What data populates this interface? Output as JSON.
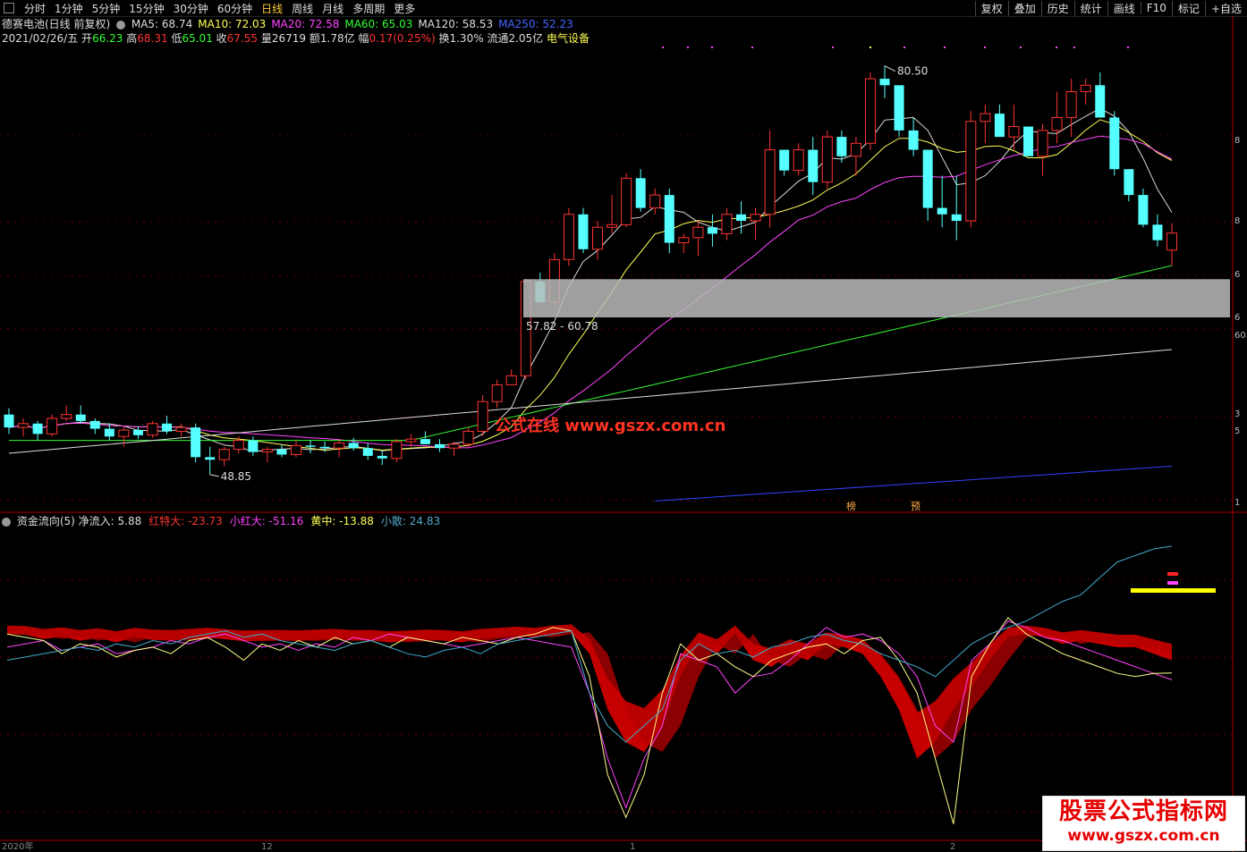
{
  "toolbar": {
    "periods": [
      "分时",
      "1分钟",
      "5分钟",
      "15分钟",
      "30分钟",
      "60分钟",
      "日线",
      "周线",
      "月线",
      "多周期",
      "更多"
    ],
    "active": "日线",
    "right": [
      "复权",
      "叠加",
      "历史",
      "统计",
      "画线",
      "F10",
      "标记",
      "+自选"
    ]
  },
  "header": {
    "stock_name": "德赛电池(日线 前复权)",
    "ma": [
      {
        "label": "MA5: 68.74",
        "color": "#dddddd"
      },
      {
        "label": "MA10: 72.03",
        "color": "#ffff55"
      },
      {
        "label": "MA20: 72.58",
        "color": "#ff44ff"
      },
      {
        "label": "MA60: 65.03",
        "color": "#33ff33"
      },
      {
        "label": "MA120: 58.53",
        "color": "#dddddd"
      },
      {
        "label": "MA250: 52.23",
        "color": "#4466ff"
      }
    ],
    "date": "2021/02/26/五",
    "open_label": "开",
    "open": "66.23",
    "high_label": "高",
    "high": "68.31",
    "low_label": "低",
    "low": "65.01",
    "close_label": "收",
    "close": "67.55",
    "volume": "量26719",
    "amount": "额1.78亿",
    "change_label": "幅",
    "change": "0.17(0.25%)",
    "turnover": "换1.30%",
    "float": "流通2.05亿",
    "sector": "电气设备"
  },
  "annotations": {
    "high_marker": "80.50",
    "low_marker": "48.85",
    "range_box": "57.82 - 60.78",
    "badge1": "榜",
    "badge2": "预"
  },
  "watermark": "公式在线 www.gszx.com.cn",
  "logo": {
    "line1": "股票公式指标网",
    "line2": "www.gszx.com.cn"
  },
  "indicator": {
    "name": "资金流向(5)",
    "items": [
      {
        "label": "净流入: 5.88",
        "color": "#dddddd"
      },
      {
        "label": "红特大: -23.73",
        "color": "#ff3333"
      },
      {
        "label": "小红大: -51.16",
        "color": "#ff44ff"
      },
      {
        "label": "黄中: -13.88",
        "color": "#ffff55"
      },
      {
        "label": "小散: 24.83",
        "color": "#55aacc"
      }
    ]
  },
  "axis": {
    "price_ticks": [
      "8",
      "8",
      "6",
      "6",
      "60.",
      "3",
      "5",
      "1",
      "5"
    ],
    "x_labels": [
      "2020年",
      "12",
      "1",
      "2"
    ]
  },
  "colors": {
    "up": "#ff3333",
    "down": "#55ffff",
    "ma5": "#dddddd",
    "ma10": "#ffff55",
    "ma20": "#ff44ff",
    "ma60": "#33ff33",
    "ma120": "#dddddd",
    "ma250": "#3344ff",
    "grid": "#660000"
  },
  "chart_data": [
    {
      "type": "candlestick",
      "title": "德赛电池(日线 前复权)",
      "ohlc": [
        [
          53.5,
          54.0,
          52.0,
          52.5
        ],
        [
          52.5,
          53.2,
          51.8,
          52.8
        ],
        [
          52.8,
          53.0,
          51.5,
          52.0
        ],
        [
          52.0,
          53.5,
          51.8,
          53.2
        ],
        [
          53.2,
          54.2,
          53.0,
          53.5
        ],
        [
          53.5,
          54.2,
          52.8,
          53.0
        ],
        [
          53.0,
          53.2,
          52.0,
          52.4
        ],
        [
          52.4,
          52.8,
          51.5,
          51.8
        ],
        [
          51.8,
          52.5,
          51.0,
          52.3
        ],
        [
          52.3,
          52.6,
          51.6,
          51.9
        ],
        [
          51.9,
          53.0,
          51.7,
          52.8
        ],
        [
          52.8,
          53.4,
          52.0,
          52.2
        ],
        [
          52.2,
          52.8,
          51.8,
          52.5
        ],
        [
          52.5,
          52.8,
          49.8,
          50.2
        ],
        [
          50.2,
          51.0,
          48.85,
          50.0
        ],
        [
          50.0,
          51.0,
          49.5,
          50.8
        ],
        [
          50.8,
          51.8,
          50.5,
          51.5
        ],
        [
          51.5,
          51.8,
          50.3,
          50.6
        ],
        [
          50.6,
          51.0,
          49.8,
          50.8
        ],
        [
          50.8,
          51.2,
          50.2,
          50.4
        ],
        [
          50.4,
          51.5,
          50.2,
          51.1
        ],
        [
          51.1,
          51.5,
          50.5,
          51.0
        ],
        [
          51.0,
          51.4,
          50.6,
          50.9
        ],
        [
          50.9,
          51.6,
          50.2,
          51.3
        ],
        [
          51.3,
          51.7,
          50.7,
          50.9
        ],
        [
          50.9,
          51.3,
          50.0,
          50.3
        ],
        [
          50.3,
          50.7,
          49.6,
          50.1
        ],
        [
          50.1,
          51.6,
          49.8,
          51.4
        ],
        [
          51.4,
          52.0,
          51.0,
          51.6
        ],
        [
          51.6,
          52.2,
          51.2,
          51.2
        ],
        [
          51.2,
          51.6,
          50.6,
          50.9
        ],
        [
          50.9,
          51.4,
          50.3,
          51.2
        ],
        [
          51.2,
          52.5,
          51.0,
          52.2
        ],
        [
          52.2,
          55.0,
          51.8,
          54.5
        ],
        [
          54.5,
          56.2,
          54.0,
          55.8
        ],
        [
          55.8,
          57.0,
          56.0,
          56.5
        ],
        [
          56.5,
          64.0,
          56.2,
          63.8
        ],
        [
          63.8,
          64.5,
          62.5,
          62.2
        ],
        [
          62.2,
          66.0,
          62.0,
          65.5
        ],
        [
          65.5,
          69.5,
          65.0,
          69.0
        ],
        [
          69.0,
          69.5,
          66.0,
          66.3
        ],
        [
          66.3,
          68.5,
          65.5,
          68.0
        ],
        [
          68.0,
          70.5,
          67.5,
          68.2
        ],
        [
          68.2,
          72.2,
          68.0,
          71.8
        ],
        [
          71.8,
          72.5,
          69.2,
          69.5
        ],
        [
          69.5,
          71.0,
          69.0,
          70.5
        ],
        [
          70.5,
          71.0,
          66.0,
          66.8
        ],
        [
          66.8,
          67.5,
          66.0,
          67.2
        ],
        [
          67.2,
          68.5,
          65.8,
          68.0
        ],
        [
          68.0,
          69.0,
          66.5,
          67.5
        ],
        [
          67.5,
          69.5,
          67.0,
          69.0
        ],
        [
          69.0,
          70.0,
          67.5,
          68.5
        ],
        [
          68.5,
          69.5,
          67.0,
          69.0
        ],
        [
          69.0,
          75.5,
          68.0,
          74.0
        ],
        [
          74.0,
          73.5,
          72.0,
          72.4
        ],
        [
          72.4,
          74.5,
          72.0,
          74.0
        ],
        [
          74.0,
          75.0,
          70.5,
          71.5
        ],
        [
          71.5,
          75.5,
          71.0,
          75.0
        ],
        [
          75.0,
          75.5,
          73.0,
          73.5
        ],
        [
          73.5,
          75.0,
          72.0,
          74.5
        ],
        [
          74.5,
          80.0,
          74.0,
          79.5
        ],
        [
          79.5,
          80.5,
          78.0,
          79.0
        ],
        [
          79.0,
          78.5,
          75.0,
          75.5
        ],
        [
          75.5,
          76.5,
          73.5,
          74.0
        ],
        [
          74.0,
          73.5,
          68.5,
          69.5
        ],
        [
          69.5,
          72.0,
          68.0,
          69.0
        ],
        [
          69.0,
          72.0,
          67.0,
          68.5
        ],
        [
          68.5,
          77.0,
          68.0,
          76.2
        ],
        [
          76.2,
          77.5,
          74.5,
          76.8
        ],
        [
          76.8,
          77.5,
          75.5,
          75.0
        ],
        [
          75.0,
          77.5,
          74.0,
          75.8
        ],
        [
          75.8,
          75.8,
          73.5,
          73.5
        ],
        [
          73.5,
          76.0,
          72.0,
          75.5
        ],
        [
          75.5,
          78.5,
          74.5,
          76.5
        ],
        [
          76.5,
          79.5,
          75.0,
          78.5
        ],
        [
          78.5,
          79.5,
          77.5,
          79.0
        ],
        [
          79.0,
          80.0,
          76.5,
          76.5
        ],
        [
          76.5,
          77.0,
          72.0,
          72.5
        ],
        [
          72.5,
          71.0,
          70.0,
          70.5
        ],
        [
          70.5,
          71.0,
          68.0,
          68.2
        ],
        [
          68.2,
          69.0,
          66.5,
          67.0
        ],
        [
          66.23,
          68.31,
          65.01,
          67.55
        ]
      ],
      "ma": {
        "MA5": 68.74,
        "MA10": 72.03,
        "MA20": 72.58,
        "MA60": 65.03,
        "MA120": 58.53,
        "MA250": 52.23
      },
      "annotations": {
        "high": 80.5,
        "low": 48.85,
        "range": [
          57.82,
          60.78
        ]
      }
    },
    {
      "type": "area",
      "title": "资金流向(5)",
      "series": [
        {
          "name": "红特大",
          "values": [
            -2,
            -2.2,
            -3.5,
            -2.8,
            -4,
            -3.2,
            -4.5,
            -3,
            -3.8,
            -4,
            -3.5,
            -3,
            -3.6,
            -4.2,
            -4,
            -3.9,
            -4.1,
            -3.8,
            -3.5,
            -4,
            -3.9,
            -4.5,
            -4.2,
            -3.8,
            -4,
            -4.5,
            -3.5,
            -3,
            -2.5,
            -3,
            -2,
            -1.5,
            -8,
            -25,
            -35,
            -38,
            -30,
            -15,
            -5,
            -8,
            -2,
            -10,
            -12,
            -8,
            -10,
            -5,
            -6,
            -8,
            -15,
            -25,
            -40,
            -35,
            -25,
            -18,
            -10,
            -3,
            -2,
            -3,
            -5,
            -4,
            -5,
            -6,
            -6,
            -8,
            -10
          ]
        },
        {
          "name": "小红大",
          "values": [
            -6,
            -5,
            -4,
            -7,
            -6,
            -5,
            -8,
            -7,
            -6,
            -4,
            -5,
            -3,
            -2,
            -4,
            -6,
            -5,
            -7,
            -5,
            -6,
            -3,
            -4,
            -2,
            -3,
            -4,
            -5,
            -6,
            -5,
            -4,
            -3,
            -4,
            -5,
            -6,
            -20,
            -40,
            -55,
            -40,
            -30,
            -8,
            -10,
            -12,
            -20,
            -15,
            -14,
            -10,
            -5,
            0,
            -3,
            -2,
            -4,
            -8,
            -15,
            -30,
            -35,
            -10,
            -5,
            2,
            0,
            -3,
            -4,
            -6,
            -8,
            -10,
            -12,
            -14,
            -16
          ]
        },
        {
          "name": "黄中",
          "values": [
            -2,
            -3,
            -4,
            -8,
            -5,
            -6,
            -9,
            -7,
            -6,
            -8,
            -4,
            -3,
            -6,
            -10,
            -5,
            -7,
            -4,
            -6,
            -3,
            -5,
            -4,
            -6,
            -3,
            -4,
            -5,
            -3,
            -4,
            -5,
            -3,
            -2,
            0,
            -1,
            -15,
            -45,
            -58,
            -45,
            -20,
            -5,
            -10,
            -8,
            -12,
            -15,
            -10,
            -8,
            -6,
            -5,
            -8,
            -4,
            -3,
            -10,
            -20,
            -40,
            -60,
            -15,
            -5,
            3,
            -2,
            -5,
            -8,
            -10,
            -12,
            -14,
            -15,
            -14,
            -13.88
          ]
        },
        {
          "name": "小散",
          "values": [
            -10,
            -9,
            -8,
            -7,
            -6,
            -7,
            -5,
            -6,
            -4,
            -5,
            -3,
            -2,
            -1,
            -3,
            -2,
            -4,
            -5,
            -6,
            -7,
            -5,
            -4,
            -6,
            -8,
            -9,
            -7,
            -6,
            -8,
            -5,
            -4,
            -3,
            -2,
            -1,
            -20,
            -30,
            -35,
            -30,
            -25,
            -10,
            -5,
            -8,
            -7,
            -9,
            -6,
            -5,
            -3,
            -2,
            -4,
            -5,
            -8,
            -10,
            -12,
            -15,
            -10,
            -5,
            -2,
            0,
            2,
            5,
            8,
            10,
            15,
            20,
            22,
            24,
            24.83
          ]
        }
      ],
      "values_note": "净流入: 5.88"
    }
  ]
}
